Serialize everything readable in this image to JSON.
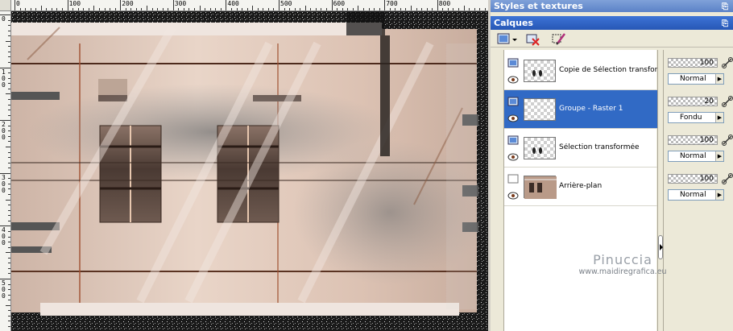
{
  "ruler": {
    "top_labels": [
      "0",
      "100",
      "200",
      "300",
      "400",
      "500",
      "600",
      "700",
      "800"
    ],
    "left_labels": [
      "0",
      "100",
      "200",
      "300",
      "400",
      "500"
    ]
  },
  "panel": {
    "styles_title": "Styles et textures",
    "layers_title": "Calques",
    "pin_glyph": "⌂"
  },
  "layers": [
    {
      "name": "Copie de Sélection transformée",
      "opacity": "100",
      "blend": "Normal",
      "selected": false,
      "type": "raster"
    },
    {
      "name": "Groupe - Raster 1",
      "opacity": "20",
      "blend": "Fondu",
      "selected": true,
      "type": "group"
    },
    {
      "name": "Sélection transformée",
      "opacity": "100",
      "blend": "Normal",
      "selected": false,
      "type": "raster"
    },
    {
      "name": "Arrière-plan",
      "opacity": "100",
      "blend": "Normal",
      "selected": false,
      "type": "background"
    }
  ],
  "watermark": {
    "name": "Pinuccia",
    "url": "www.maidiregrafica.eu"
  },
  "colors": {
    "selection": "#316ac5",
    "title_active": "#2757b6",
    "title_inactive": "#5b82c7"
  }
}
